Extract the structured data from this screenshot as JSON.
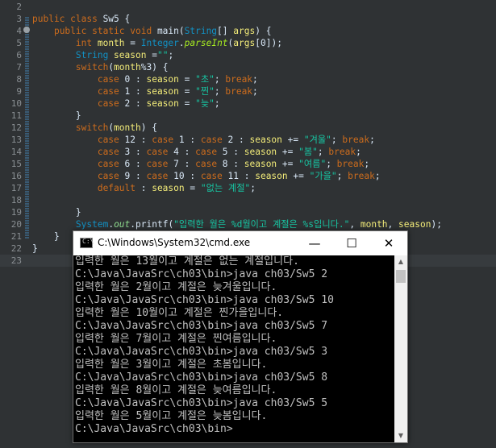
{
  "editor": {
    "lines": [
      {
        "n": "2",
        "tokens": []
      },
      {
        "n": "3",
        "tokens": [
          {
            "c": "kw",
            "t": "public class "
          },
          {
            "c": "pl",
            "t": "Sw5 {"
          }
        ]
      },
      {
        "n": "4",
        "fold": true,
        "tokens": [
          {
            "c": "pl",
            "t": "    "
          },
          {
            "c": "kw",
            "t": "public static void "
          },
          {
            "c": "pl",
            "t": "main("
          },
          {
            "c": "ty",
            "t": "String"
          },
          {
            "c": "pl",
            "t": "[] "
          },
          {
            "c": "vr",
            "t": "args"
          },
          {
            "c": "pl",
            "t": ") {"
          }
        ]
      },
      {
        "n": "5",
        "tokens": [
          {
            "c": "pl",
            "t": "        "
          },
          {
            "c": "kw",
            "t": "int "
          },
          {
            "c": "vr",
            "t": "month"
          },
          {
            "c": "pl",
            "t": " = "
          },
          {
            "c": "ty",
            "t": "Integer"
          },
          {
            "c": "pl",
            "t": "."
          },
          {
            "c": "fn",
            "t": "parseInt"
          },
          {
            "c": "pl",
            "t": "("
          },
          {
            "c": "vr",
            "t": "args"
          },
          {
            "c": "pl",
            "t": "[0]);"
          }
        ]
      },
      {
        "n": "6",
        "tokens": [
          {
            "c": "pl",
            "t": "        "
          },
          {
            "c": "ty",
            "t": "String "
          },
          {
            "c": "vr",
            "t": "season"
          },
          {
            "c": "pl",
            "t": " ="
          },
          {
            "c": "st",
            "t": "\"\""
          },
          {
            "c": "pl",
            "t": ";"
          }
        ]
      },
      {
        "n": "7",
        "tokens": [
          {
            "c": "pl",
            "t": "        "
          },
          {
            "c": "kw",
            "t": "switch"
          },
          {
            "c": "pl",
            "t": "("
          },
          {
            "c": "vr",
            "t": "month"
          },
          {
            "c": "pl",
            "t": "%3) {"
          }
        ]
      },
      {
        "n": "8",
        "tokens": [
          {
            "c": "pl",
            "t": "            "
          },
          {
            "c": "kw",
            "t": "case "
          },
          {
            "c": "pl",
            "t": "0 : "
          },
          {
            "c": "vr",
            "t": "season"
          },
          {
            "c": "pl",
            "t": " = "
          },
          {
            "c": "st",
            "t": "\"초\""
          },
          {
            "c": "pl",
            "t": "; "
          },
          {
            "c": "kw",
            "t": "break"
          },
          {
            "c": "pl",
            "t": ";"
          }
        ]
      },
      {
        "n": "9",
        "tokens": [
          {
            "c": "pl",
            "t": "            "
          },
          {
            "c": "kw",
            "t": "case "
          },
          {
            "c": "pl",
            "t": "1 : "
          },
          {
            "c": "vr",
            "t": "season"
          },
          {
            "c": "pl",
            "t": " = "
          },
          {
            "c": "st",
            "t": "\"찐\""
          },
          {
            "c": "pl",
            "t": "; "
          },
          {
            "c": "kw",
            "t": "break"
          },
          {
            "c": "pl",
            "t": ";"
          }
        ]
      },
      {
        "n": "10",
        "tokens": [
          {
            "c": "pl",
            "t": "            "
          },
          {
            "c": "kw",
            "t": "case "
          },
          {
            "c": "pl",
            "t": "2 : "
          },
          {
            "c": "vr",
            "t": "season"
          },
          {
            "c": "pl",
            "t": " = "
          },
          {
            "c": "st",
            "t": "\"늦\""
          },
          {
            "c": "pl",
            "t": ";"
          }
        ]
      },
      {
        "n": "11",
        "tokens": [
          {
            "c": "pl",
            "t": "        }"
          }
        ]
      },
      {
        "n": "12",
        "tokens": [
          {
            "c": "pl",
            "t": "        "
          },
          {
            "c": "kw",
            "t": "switch"
          },
          {
            "c": "pl",
            "t": "("
          },
          {
            "c": "vr",
            "t": "month"
          },
          {
            "c": "pl",
            "t": ") {"
          }
        ]
      },
      {
        "n": "13",
        "tokens": [
          {
            "c": "pl",
            "t": "            "
          },
          {
            "c": "kw",
            "t": "case "
          },
          {
            "c": "pl",
            "t": "12 : "
          },
          {
            "c": "kw",
            "t": "case "
          },
          {
            "c": "pl",
            "t": "1 : "
          },
          {
            "c": "kw",
            "t": "case "
          },
          {
            "c": "pl",
            "t": "2 : "
          },
          {
            "c": "vr",
            "t": "season"
          },
          {
            "c": "pl",
            "t": " += "
          },
          {
            "c": "st",
            "t": "\"겨울\""
          },
          {
            "c": "pl",
            "t": "; "
          },
          {
            "c": "kw",
            "t": "break"
          },
          {
            "c": "pl",
            "t": ";"
          }
        ]
      },
      {
        "n": "14",
        "tokens": [
          {
            "c": "pl",
            "t": "            "
          },
          {
            "c": "kw",
            "t": "case "
          },
          {
            "c": "pl",
            "t": "3 : "
          },
          {
            "c": "kw",
            "t": "case "
          },
          {
            "c": "pl",
            "t": "4 : "
          },
          {
            "c": "kw",
            "t": "case "
          },
          {
            "c": "pl",
            "t": "5 : "
          },
          {
            "c": "vr",
            "t": "season"
          },
          {
            "c": "pl",
            "t": " += "
          },
          {
            "c": "st",
            "t": "\"봄\""
          },
          {
            "c": "pl",
            "t": "; "
          },
          {
            "c": "kw",
            "t": "break"
          },
          {
            "c": "pl",
            "t": ";"
          }
        ]
      },
      {
        "n": "15",
        "tokens": [
          {
            "c": "pl",
            "t": "            "
          },
          {
            "c": "kw",
            "t": "case "
          },
          {
            "c": "pl",
            "t": "6 : "
          },
          {
            "c": "kw",
            "t": "case "
          },
          {
            "c": "pl",
            "t": "7 : "
          },
          {
            "c": "kw",
            "t": "case "
          },
          {
            "c": "pl",
            "t": "8 : "
          },
          {
            "c": "vr",
            "t": "season"
          },
          {
            "c": "pl",
            "t": " += "
          },
          {
            "c": "st",
            "t": "\"여름\""
          },
          {
            "c": "pl",
            "t": "; "
          },
          {
            "c": "kw",
            "t": "break"
          },
          {
            "c": "pl",
            "t": ";"
          }
        ]
      },
      {
        "n": "16",
        "tokens": [
          {
            "c": "pl",
            "t": "            "
          },
          {
            "c": "kw",
            "t": "case "
          },
          {
            "c": "pl",
            "t": "9 : "
          },
          {
            "c": "kw",
            "t": "case "
          },
          {
            "c": "pl",
            "t": "10 : "
          },
          {
            "c": "kw",
            "t": "case "
          },
          {
            "c": "pl",
            "t": "11 : "
          },
          {
            "c": "vr",
            "t": "season"
          },
          {
            "c": "pl",
            "t": " += "
          },
          {
            "c": "st",
            "t": "\"가을\""
          },
          {
            "c": "pl",
            "t": "; "
          },
          {
            "c": "kw",
            "t": "break"
          },
          {
            "c": "pl",
            "t": ";"
          }
        ]
      },
      {
        "n": "17",
        "tokens": [
          {
            "c": "pl",
            "t": "            "
          },
          {
            "c": "kw",
            "t": "default "
          },
          {
            "c": "pl",
            "t": ": "
          },
          {
            "c": "vr",
            "t": "season"
          },
          {
            "c": "pl",
            "t": " = "
          },
          {
            "c": "st",
            "t": "\"없는 계절\""
          },
          {
            "c": "pl",
            "t": ";"
          }
        ]
      },
      {
        "n": "18",
        "tokens": []
      },
      {
        "n": "19",
        "tokens": [
          {
            "c": "pl",
            "t": "        }"
          }
        ]
      },
      {
        "n": "20",
        "tokens": [
          {
            "c": "pl",
            "t": "        "
          },
          {
            "c": "ty",
            "t": "System"
          },
          {
            "c": "pl",
            "t": "."
          },
          {
            "c": "fld",
            "t": "out"
          },
          {
            "c": "pl",
            "t": "."
          },
          {
            "c": "pl",
            "t": "printf("
          },
          {
            "c": "st",
            "t": "\"입력한 월은 %d월이고 계절은 %s입니다.\""
          },
          {
            "c": "pl",
            "t": ", "
          },
          {
            "c": "vr",
            "t": "month"
          },
          {
            "c": "pl",
            "t": ", "
          },
          {
            "c": "vr",
            "t": "season"
          },
          {
            "c": "pl",
            "t": ");"
          }
        ]
      },
      {
        "n": "21",
        "tokens": [
          {
            "c": "pl",
            "t": "    }"
          }
        ]
      },
      {
        "n": "22",
        "tokens": [
          {
            "c": "pl",
            "t": "}"
          }
        ]
      },
      {
        "n": "23",
        "active": true,
        "tokens": []
      }
    ]
  },
  "cmd": {
    "title": "C:\\Windows\\System32\\cmd.exe",
    "icon": "cmd-app-icon",
    "minimize": "—",
    "maximize": "☐",
    "close": "✕",
    "output": [
      "입력한 월은 13월이고 계절은 없는 계절입니다.",
      "C:\\Java\\JavaSrc\\ch03\\bin>java ch03/Sw5 2",
      "입력한 월은 2월이고 계절은 늦겨울입니다.",
      "C:\\Java\\JavaSrc\\ch03\\bin>java ch03/Sw5 10",
      "입력한 월은 10월이고 계절은 찐가을입니다.",
      "C:\\Java\\JavaSrc\\ch03\\bin>java ch03/Sw5 7",
      "입력한 월은 7월이고 계절은 찐여름입니다.",
      "C:\\Java\\JavaSrc\\ch03\\bin>java ch03/Sw5 3",
      "입력한 월은 3월이고 계절은 초봄입니다.",
      "C:\\Java\\JavaSrc\\ch03\\bin>java ch03/Sw5 8",
      "입력한 월은 8월이고 계절은 늦여름입니다.",
      "C:\\Java\\JavaSrc\\ch03\\bin>java ch03/Sw5 5",
      "입력한 월은 5월이고 계절은 늦봄입니다.",
      "C:\\Java\\JavaSrc\\ch03\\bin>"
    ]
  }
}
